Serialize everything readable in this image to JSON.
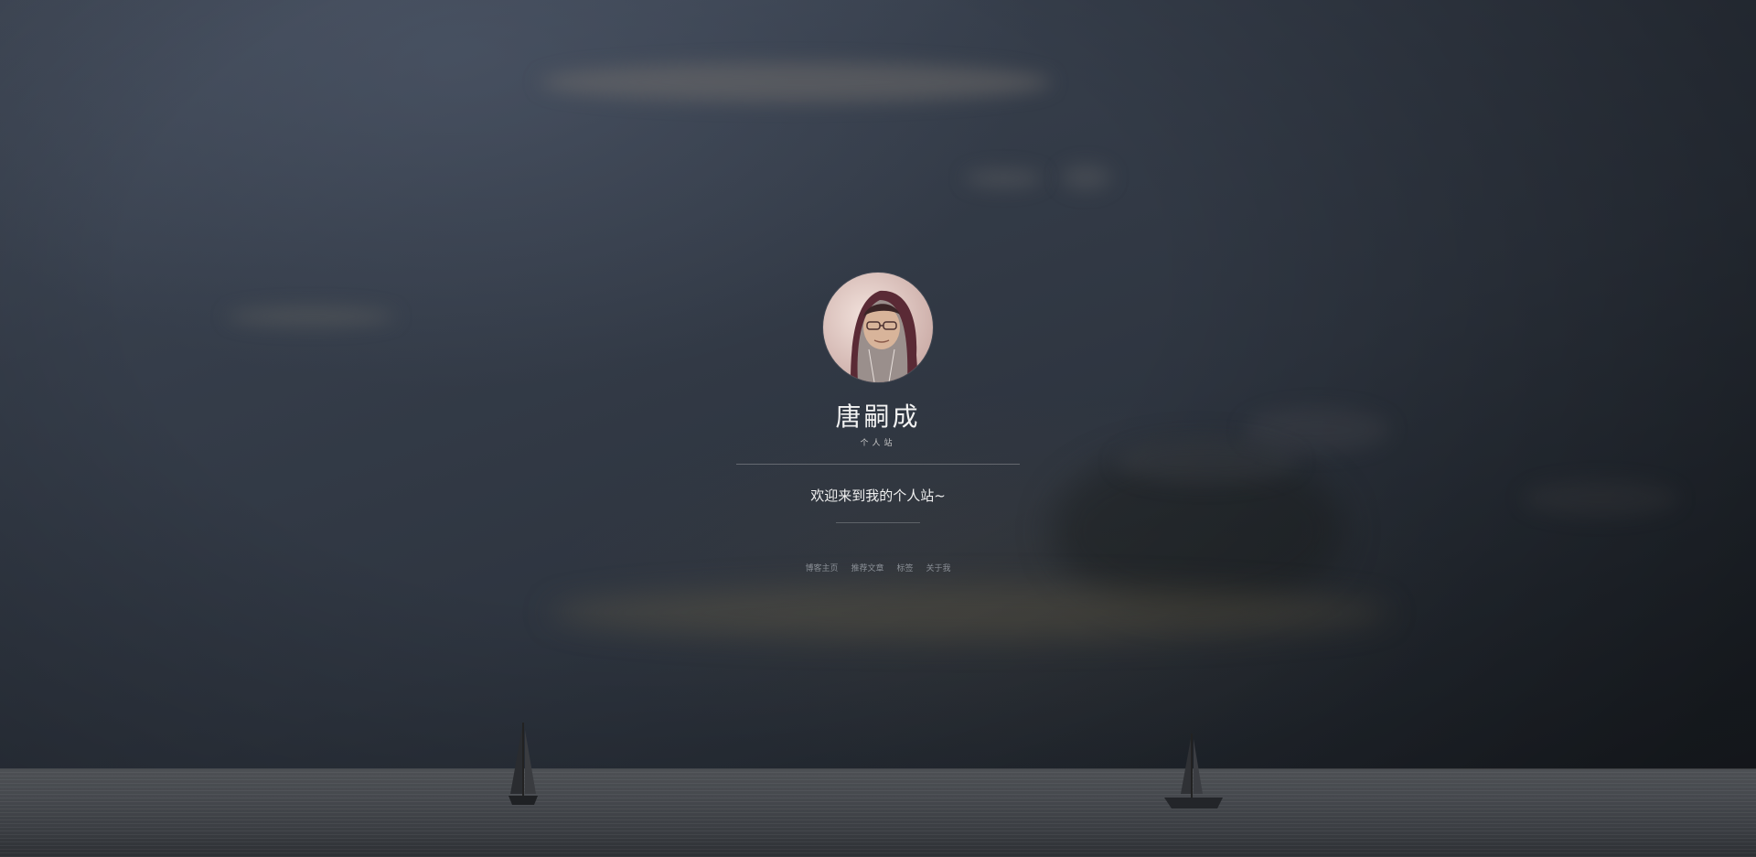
{
  "profile": {
    "name": "唐嗣成",
    "subtitle": "个人站",
    "welcome": "欢迎来到我的个人站~"
  },
  "nav": {
    "items": [
      {
        "label": "博客主页"
      },
      {
        "label": "推荐文章"
      },
      {
        "label": "标签"
      },
      {
        "label": "关于我"
      }
    ]
  },
  "colors": {
    "sky_top": "#434c5b",
    "sky_bottom": "#1b1f25",
    "sea": "#46494e",
    "text_primary": "#f2f2f2",
    "nav_text": "#8a8f96"
  }
}
